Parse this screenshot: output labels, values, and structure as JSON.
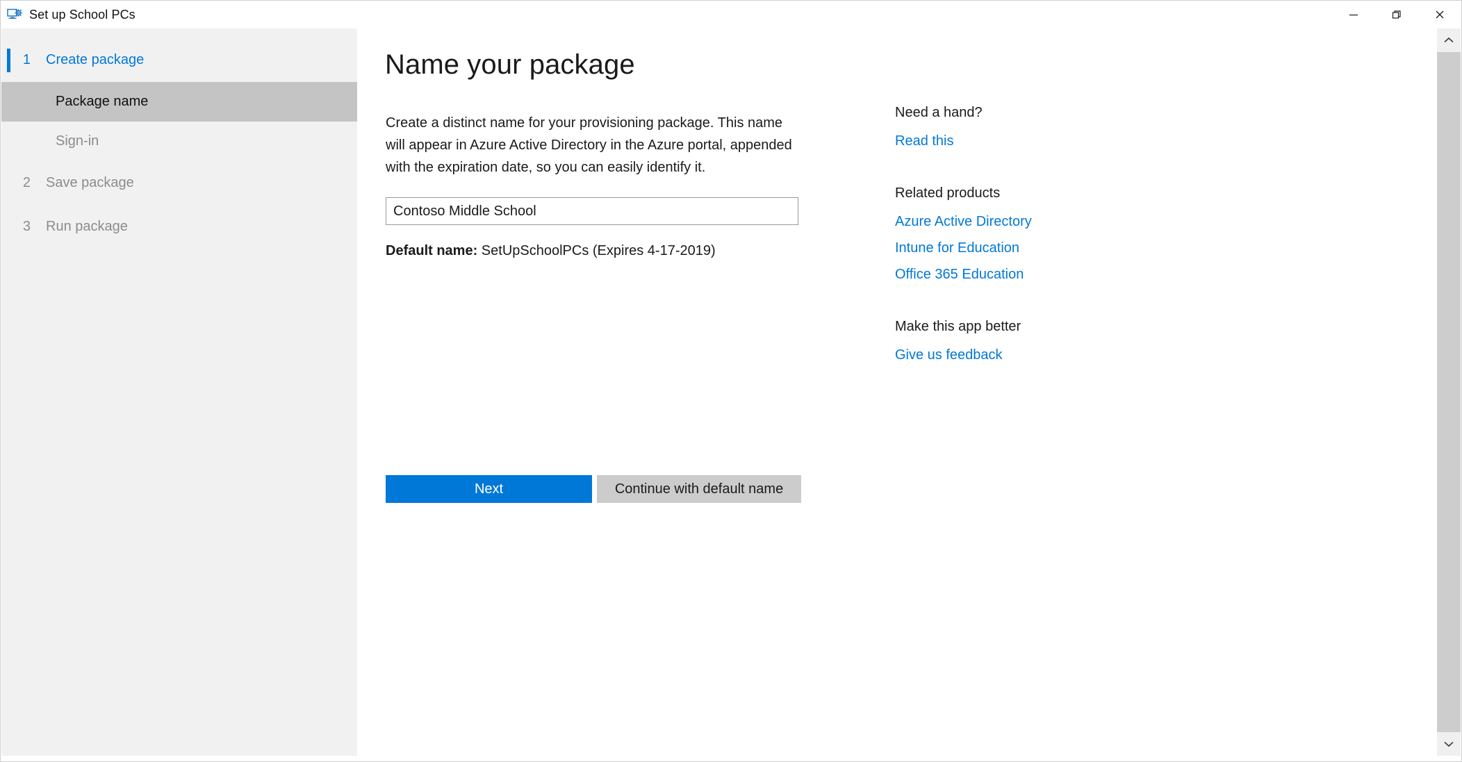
{
  "window": {
    "title": "Set up School PCs",
    "app_icon": "monitor-gear-icon",
    "controls": {
      "minimize": "minimize-icon",
      "restore": "restore-icon",
      "close": "close-icon"
    }
  },
  "colors": {
    "accent": "#0078d7",
    "sidebar_bg": "#f1f1f1",
    "selected_bg": "#c4c4c4",
    "secondary_button_bg": "#cccccc",
    "disabled_text": "#8c8c8c"
  },
  "sidebar": {
    "steps": [
      {
        "number": "1",
        "label": "Create package",
        "state": "active",
        "subitems": [
          {
            "label": "Package name",
            "state": "selected"
          },
          {
            "label": "Sign-in",
            "state": "disabled"
          }
        ]
      },
      {
        "number": "2",
        "label": "Save package",
        "state": "inactive",
        "subitems": []
      },
      {
        "number": "3",
        "label": "Run package",
        "state": "inactive",
        "subitems": []
      }
    ]
  },
  "main": {
    "title": "Name your package",
    "description": "Create a distinct name for your provisioning package. This name will appear in Azure Active Directory in the Azure portal, appended with the expiration date, so you can easily identify it.",
    "package_name_input": {
      "value": "Contoso Middle School",
      "placeholder": "Contoso Middle School"
    },
    "default_name": {
      "label": "Default name:",
      "value": " SetUpSchoolPCs (Expires 4-17-2019)"
    },
    "buttons": {
      "next": "Next",
      "continue_default": "Continue with default name"
    }
  },
  "help": {
    "groups": [
      {
        "heading": "Need a hand?",
        "links": [
          "Read this"
        ]
      },
      {
        "heading": "Related products",
        "links": [
          "Azure Active Directory",
          "Intune for Education",
          "Office 365 Education"
        ]
      },
      {
        "heading": "Make this app better",
        "links": [
          "Give us feedback"
        ]
      }
    ]
  },
  "scrollbar": {
    "up_arrow": "chevron-up-icon",
    "down_arrow": "chevron-down-icon"
  }
}
